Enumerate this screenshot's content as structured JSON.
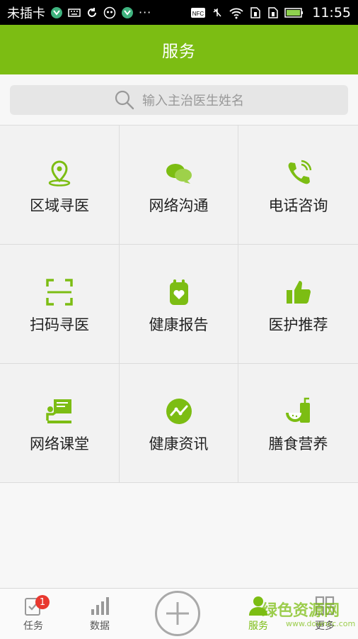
{
  "status_bar": {
    "carrier": "未插卡",
    "time": "11:55",
    "overflow": "···",
    "nfc": "NFC"
  },
  "header": {
    "title": "服务"
  },
  "search": {
    "placeholder": "输入主治医生姓名",
    "icon": "search-icon"
  },
  "colors": {
    "brand": "#7cbd13",
    "badge": "#e8382f",
    "text": "#222222"
  },
  "services": [
    {
      "label": "区域寻医",
      "icon": "location-pin-icon"
    },
    {
      "label": "网络沟通",
      "icon": "chat-bubbles-icon"
    },
    {
      "label": "电话咨询",
      "icon": "phone-icon"
    },
    {
      "label": "扫码寻医",
      "icon": "scan-icon"
    },
    {
      "label": "健康报告",
      "icon": "health-report-icon"
    },
    {
      "label": "医护推荐",
      "icon": "thumbs-up-icon"
    },
    {
      "label": "网络课堂",
      "icon": "classroom-icon"
    },
    {
      "label": "健康资讯",
      "icon": "trend-icon"
    },
    {
      "label": "膳食营养",
      "icon": "watermelon-drink-icon"
    }
  ],
  "bottom_nav": {
    "tasks": {
      "label": "任务",
      "badge": "1"
    },
    "data": {
      "label": "数据"
    },
    "service": {
      "label": "服务"
    },
    "more": {
      "label": "更多"
    }
  },
  "watermark": {
    "text": "绿色资源网",
    "url": "www.downcc.com"
  }
}
